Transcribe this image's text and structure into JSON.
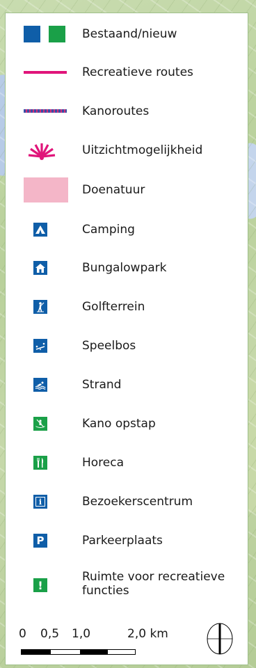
{
  "legend": {
    "items": [
      {
        "key": "bestaand_nieuw",
        "label": "Bestaand/nieuw",
        "colors": [
          "#0f5ea8",
          "#1aa048"
        ]
      },
      {
        "key": "recreatieve_routes",
        "label": "Recreatieve routes",
        "color": "#e0157a"
      },
      {
        "key": "kanoroutes",
        "label": "Kanoroutes",
        "colors": [
          "#3a4fa8",
          "#d2307a"
        ]
      },
      {
        "key": "uitzicht",
        "label": "Uitzichtmogelijkheid",
        "color": "#e0157a"
      },
      {
        "key": "doenatuur",
        "label": "Doenatuur",
        "color": "#f4b6c8"
      },
      {
        "key": "camping",
        "label": "Camping",
        "icon": "tent-icon"
      },
      {
        "key": "bungalowpark",
        "label": "Bungalowpark",
        "icon": "house-icon"
      },
      {
        "key": "golfterrein",
        "label": "Golfterrein",
        "icon": "golfer-icon"
      },
      {
        "key": "speelbos",
        "label": "Speelbos",
        "icon": "seesaw-icon"
      },
      {
        "key": "strand",
        "label": "Strand",
        "icon": "swimmer-icon"
      },
      {
        "key": "kano_opstap",
        "label": "Kano opstap",
        "icon": "canoe-icon"
      },
      {
        "key": "horeca",
        "label": "Horeca",
        "icon": "cutlery-icon"
      },
      {
        "key": "bezoekerscentrum",
        "label": "Bezoekerscentrum",
        "icon": "info-icon",
        "glyph": "i"
      },
      {
        "key": "parkeerplaats",
        "label": "Parkeerplaats",
        "icon": "parking-icon",
        "glyph": "P"
      },
      {
        "key": "ruimte",
        "label": "Ruimte voor recreatieve\nfuncties",
        "label_line1": "Ruimte voor recreatieve",
        "label_line2": "functies",
        "icon": "exclamation-icon",
        "glyph": "!"
      }
    ]
  },
  "scale": {
    "ticks": [
      "0",
      "0,5",
      "1,0",
      "2,0 km"
    ]
  },
  "north_arrow": {
    "icon": "north-arrow-icon"
  }
}
